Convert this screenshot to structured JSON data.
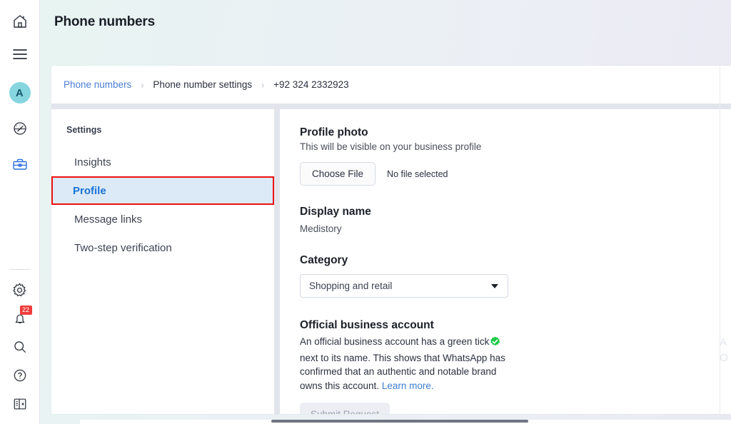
{
  "rail": {
    "items": [
      {
        "name": "home-icon",
        "label": "Home"
      },
      {
        "name": "menu-icon",
        "label": "Menu"
      },
      {
        "name": "avatar",
        "label": "A"
      },
      {
        "name": "dashboard-icon",
        "label": "Dashboard"
      },
      {
        "name": "toolbox-icon",
        "label": "Toolbox"
      }
    ],
    "bottom_items": [
      {
        "name": "gear-icon",
        "label": "Settings"
      },
      {
        "name": "bell-icon",
        "label": "Notifications",
        "badge": "22"
      },
      {
        "name": "search-icon",
        "label": "Search"
      },
      {
        "name": "help-icon",
        "label": "Help"
      },
      {
        "name": "panel-toggle-icon",
        "label": "Toggle panel"
      }
    ]
  },
  "header": {
    "title": "Phone numbers"
  },
  "breadcrumb": {
    "items": [
      {
        "label": "Phone numbers",
        "type": "link"
      },
      {
        "label": "Phone number settings",
        "type": "text"
      },
      {
        "label": "+92 324 2332923",
        "type": "current"
      }
    ],
    "separator": "›"
  },
  "settings_nav": {
    "heading": "Settings",
    "items": [
      {
        "label": "Insights",
        "active": false
      },
      {
        "label": "Profile",
        "active": true
      },
      {
        "label": "Message links",
        "active": false
      },
      {
        "label": "Two-step verification",
        "active": false
      }
    ]
  },
  "profile": {
    "photo": {
      "title": "Profile photo",
      "subtitle": "This will be visible on your business profile",
      "choose_file_label": "Choose File",
      "file_status": "No file selected"
    },
    "display_name": {
      "title": "Display name",
      "value": "Medistory"
    },
    "category": {
      "title": "Category",
      "selected": "Shopping and retail"
    },
    "official": {
      "title": "Official business account",
      "text_part1": "An official business account has a green tick",
      "text_part2": "next to its name. This shows that WhatsApp has confirmed that an authentic and notable brand owns this account.",
      "learn_more": "Learn more.",
      "submit_label": "Submit Request"
    }
  },
  "colors": {
    "accent_blue": "#1a73d6",
    "highlight_border": "#ee1111",
    "highlight_bg": "#dceaf7",
    "green_tick": "#1fc84a",
    "badge_red": "#f03c3c",
    "avatar_bg": "#86d6e0"
  }
}
